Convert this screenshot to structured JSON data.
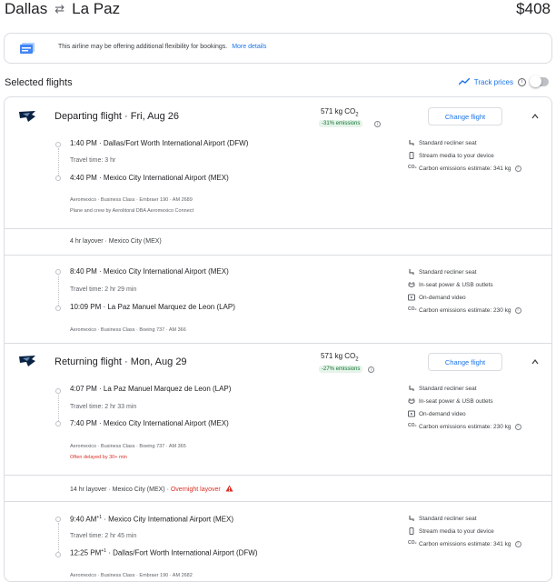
{
  "header": {
    "origin": "Dallas",
    "destination": "La Paz",
    "price": "$408"
  },
  "notice": {
    "text": "This airline may be offering additional flexibility for bookings.",
    "link": "More details"
  },
  "selected": {
    "title": "Selected flights",
    "track_label": "Track prices"
  },
  "departing": {
    "title": "Departing flight",
    "date": "Fri, Aug 26",
    "co2_value": "571 kg CO",
    "co2_sub": "2",
    "emissions": "-31% emissions",
    "change_label": "Change flight",
    "legs": [
      {
        "dep_time": "1:40 PM",
        "dep_airport": "Dallas/Fort Worth International Airport (DFW)",
        "travel_time": "Travel time: 3 hr",
        "arr_time": "4:40 PM",
        "arr_airport": "Mexico City International Airport (MEX)",
        "meta": "Aeromexico · Business Class · Embraer 190 · AM 2689",
        "meta2": "Plane and crew by Aerolitoral DBA Aeromexico Connect",
        "amenities": [
          "Standard recliner seat",
          "Stream media to your device",
          "Carbon emissions estimate: 341 kg"
        ]
      },
      {
        "dep_time": "8:40 PM",
        "dep_airport": "Mexico City International Airport (MEX)",
        "travel_time": "Travel time: 2 hr 29 min",
        "arr_time": "10:09 PM",
        "arr_airport": "La Paz Manuel Marquez de Leon (LAP)",
        "meta": "Aeromexico · Business Class · Boeing 737 · AM 366",
        "amenities": [
          "Standard recliner seat",
          "In-seat power & USB outlets",
          "On-demand video",
          "Carbon emissions estimate: 230 kg"
        ]
      }
    ],
    "layover": "4 hr layover · Mexico City (MEX)"
  },
  "returning": {
    "title": "Returning flight",
    "date": "Mon, Aug 29",
    "co2_value": "571 kg CO",
    "co2_sub": "2",
    "emissions": "-27% emissions",
    "change_label": "Change flight",
    "legs": [
      {
        "dep_time": "4:07 PM",
        "dep_airport": "La Paz Manuel Marquez de Leon (LAP)",
        "travel_time": "Travel time: 2 hr 33 min",
        "arr_time": "7:40 PM",
        "arr_airport": "Mexico City International Airport (MEX)",
        "meta": "Aeromexico · Business Class · Boeing 737 · AM 365",
        "warning": "Often delayed by 30+ min",
        "amenities": [
          "Standard recliner seat",
          "In-seat power & USB outlets",
          "On-demand video",
          "Carbon emissions estimate: 230 kg"
        ]
      },
      {
        "dep_time": "9:40 AM",
        "dep_sup": "+1",
        "dep_airport": "Mexico City International Airport (MEX)",
        "travel_time": "Travel time: 2 hr 45 min",
        "arr_time": "12:25 PM",
        "arr_sup": "+1",
        "arr_airport": "Dallas/Fort Worth International Airport (DFW)",
        "meta": "Aeromexico · Business Class · Embraer 190 · AM 2682",
        "amenities": [
          "Standard recliner seat",
          "Stream media to your device",
          "Carbon emissions estimate: 341 kg"
        ]
      }
    ],
    "layover": "14 hr layover · Mexico City (MEX) · ",
    "layover_warning": "Overnight layover"
  },
  "colors": {
    "link": "#1a73e8",
    "emissions_bg": "#e6f4ea",
    "emissions_text": "#137333",
    "warning": "#d93025"
  }
}
